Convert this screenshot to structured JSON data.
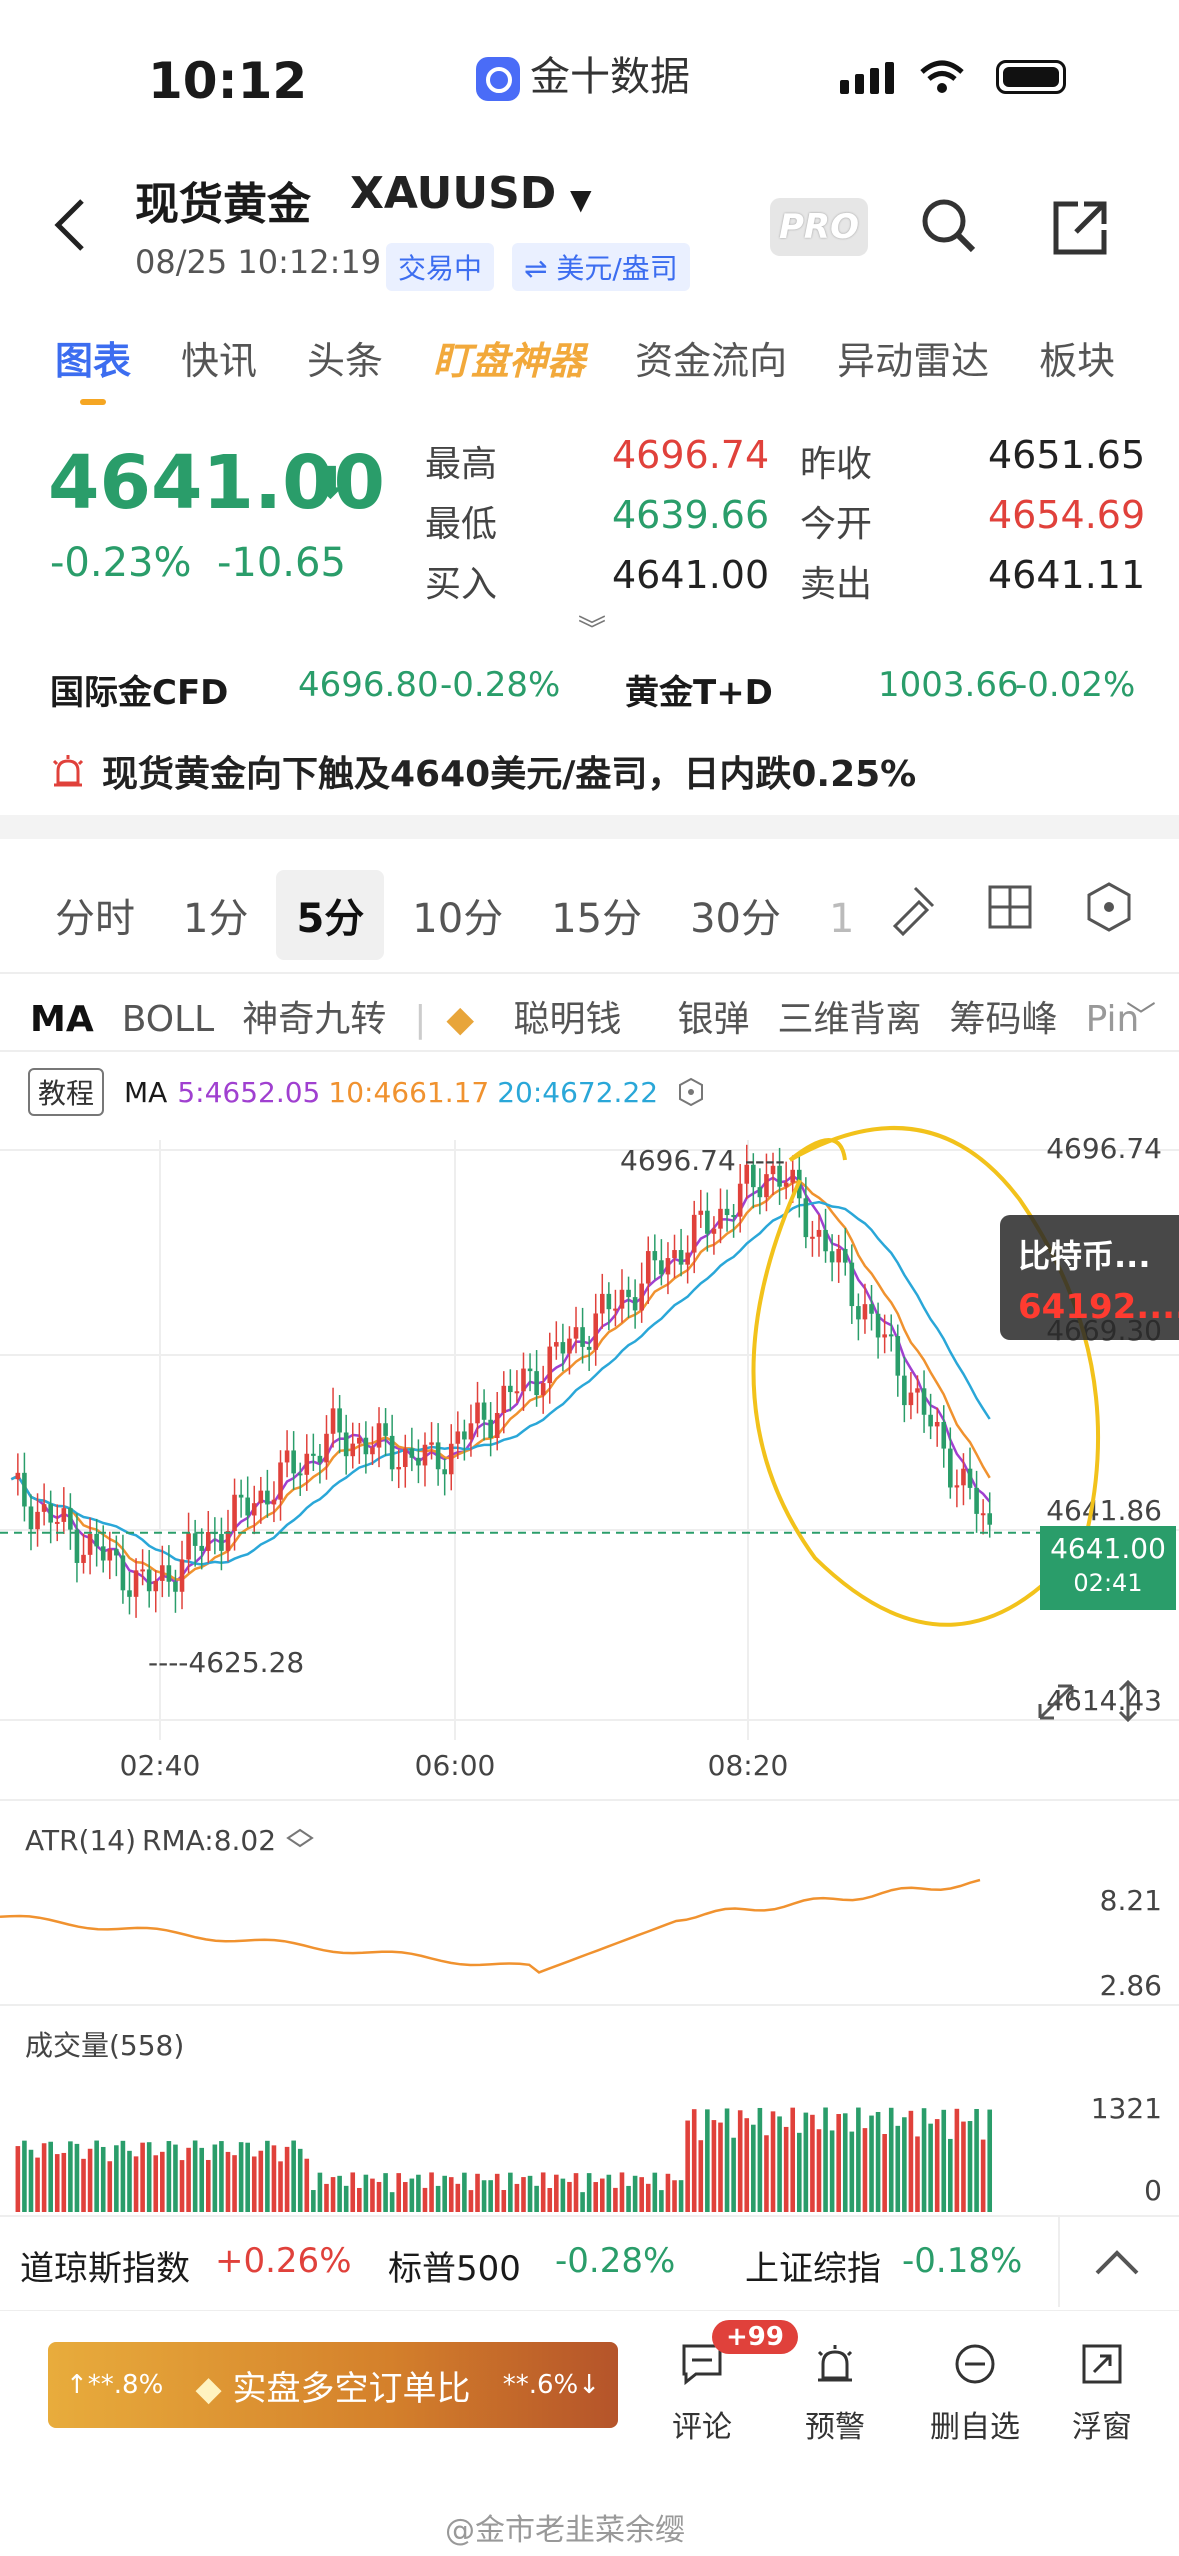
{
  "status_bar": {
    "time": "10:12",
    "app_name": "金十数据"
  },
  "header": {
    "title": "现货黄金",
    "symbol": "XAUUSD",
    "pro": "PRO",
    "datetime": "08/25 10:12:19",
    "trade_status": "交易中",
    "unit": "⇌ 美元/盎司"
  },
  "tabs": [
    "图表",
    "快讯",
    "头条",
    "盯盘神器",
    "资金流向",
    "异动雷达",
    "板块"
  ],
  "quote": {
    "price": "4641.00",
    "change_pct": "-0.23%",
    "change": "-10.65",
    "high_label": "最高",
    "high": "4696.74",
    "low_label": "最低",
    "low": "4639.66",
    "bid_label": "买入",
    "bid": "4641.00",
    "prev_label": "昨收",
    "prev": "4651.65",
    "open_label": "今开",
    "open": "4654.69",
    "ask_label": "卖出",
    "ask": "4641.11"
  },
  "related": {
    "a_name": "国际金CFD",
    "a_price": "4696.80",
    "a_chg": "-0.28%",
    "b_name": "黄金T+D",
    "b_price": "1003.66",
    "b_chg": "-0.02%"
  },
  "alert_text": "现货黄金向下触及4640美元/盎司，日内跌0.25%",
  "periods": [
    "分时",
    "1分",
    "5分",
    "10分",
    "15分",
    "30分",
    "1"
  ],
  "active_period": "5分",
  "indicators": [
    "MA",
    "BOLL",
    "神奇九转",
    "聪明钱",
    "银弹",
    "三维背离",
    "筹码峰",
    "Pin"
  ],
  "ma_line": {
    "tutorial": "教程",
    "label": "MA",
    "ma5": "5:4652.05",
    "ma10": "10:4661.17",
    "ma20": "20:4672.22"
  },
  "chart_data": {
    "type": "candlestick",
    "y_ticks": [
      "4696.74",
      "4669.30",
      "4641.86",
      "4614.43"
    ],
    "x_ticks": [
      "02:40",
      "06:00",
      "08:20"
    ],
    "high_marker": "4696.74",
    "low_marker": "4625.28",
    "current": "4641.00",
    "countdown": "02:41",
    "ylim": [
      4614.43,
      4696.74
    ],
    "atr_label": "ATR(14)",
    "atr_rma": "RMA:8.02",
    "atr_ticks": [
      "8.21",
      "2.86"
    ],
    "vol_label": "成交量(558)",
    "vol_ticks": [
      "1321",
      "0"
    ],
    "colors": {
      "up": "#e0413b",
      "down": "#2a9d6a",
      "ma5": "#a040d0",
      "ma10": "#f0922f",
      "ma20": "#2aa7d8"
    }
  },
  "tooltip": {
    "name": "比特币...",
    "value": "64192...."
  },
  "bottom_indices": [
    {
      "name": "道琼斯指数",
      "chg": "+0.26%"
    },
    {
      "name": "标普500",
      "chg": "-0.28%"
    },
    {
      "name": "上证综指",
      "chg": "-0.18%"
    }
  ],
  "action_bar": {
    "ratio_left": "↑**.8%",
    "ratio_text": "实盘多空订单比",
    "ratio_right": "**.6%↓",
    "comment": "评论",
    "badge": "+99",
    "alert": "预警",
    "remove": "删自选",
    "float": "浮窗"
  },
  "watermark": "@金市老韭菜余缨"
}
